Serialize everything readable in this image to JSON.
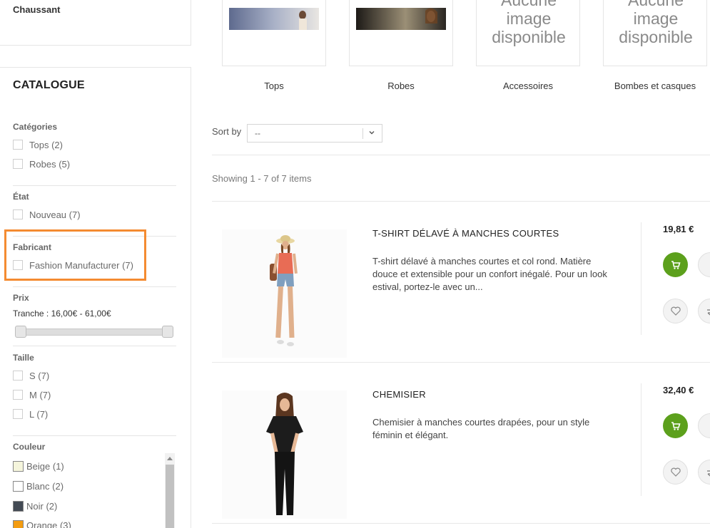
{
  "sidebar": {
    "top_link": "Chaussant",
    "catalogue_title": "CATALOGUE",
    "facets": {
      "categories": {
        "title": "Catégories",
        "options": [
          "Tops (2)",
          "Robes (5)"
        ]
      },
      "etat": {
        "title": "État",
        "options": [
          "Nouveau (7)"
        ]
      },
      "fabricant": {
        "title": "Fabricant",
        "options": [
          "Fashion Manufacturer (7)"
        ]
      },
      "prix": {
        "title": "Prix",
        "range_label": "Tranche : 16,00€ - 61,00€"
      },
      "taille": {
        "title": "Taille",
        "options": [
          "S (7)",
          "M (7)",
          "L (7)"
        ]
      },
      "couleur": {
        "title": "Couleur",
        "options": [
          {
            "label": "Beige (1)",
            "color": "#f5f5dc"
          },
          {
            "label": "Blanc (2)",
            "color": "#ffffff"
          },
          {
            "label": "Noir (2)",
            "color": "#434a54"
          },
          {
            "label": "Orange (3)",
            "color": "#f39c11"
          }
        ]
      }
    }
  },
  "subcategories": [
    {
      "name": "Tops",
      "image": "photo"
    },
    {
      "name": "Robes",
      "image": "photo"
    },
    {
      "name": "Accessoires",
      "image": "none",
      "no_image_text": "Aucune image disponible"
    },
    {
      "name": "Bombes et casques",
      "image": "none",
      "no_image_text": "Aucune image disponible"
    }
  ],
  "sort": {
    "label": "Sort by",
    "value": "--"
  },
  "showing": "Showing 1 - 7 of 7 items",
  "products": [
    {
      "name": "T-SHIRT DÉLAVÉ À MANCHES COURTES",
      "description": "T-shirt délavé à manches courtes et col rond. Matière douce et extensible pour un confort inégalé. Pour un look estival, portez-le avec un...",
      "price": "19,81 €"
    },
    {
      "name": "CHEMISIER",
      "description": "Chemisier à manches courtes drapées, pour un style féminin et élégant.",
      "price": "32,40 €"
    }
  ],
  "colors": {
    "accent_green": "#5ca01c",
    "highlight_orange": "#f48b31"
  },
  "icons": [
    "cart-icon",
    "heart-icon",
    "compare-icon",
    "chevron-down-icon"
  ]
}
